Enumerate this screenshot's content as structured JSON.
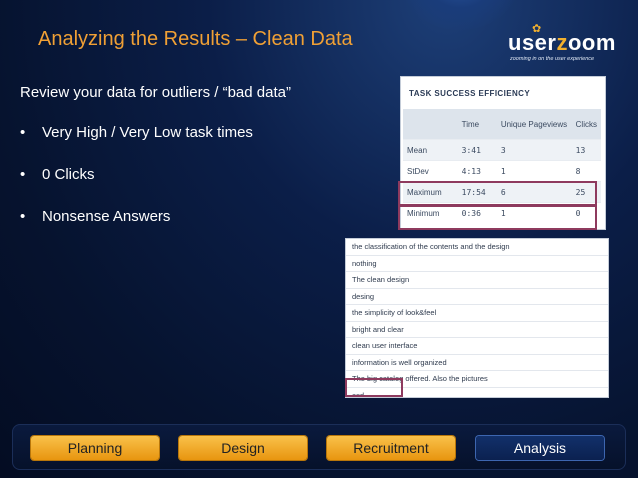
{
  "slide": {
    "title": "Analyzing the Results – Clean Data",
    "intro": "Review your data for outliers / “bad data”",
    "bullets": [
      "Very High / Very Low task times",
      "0 Clicks",
      "Nonsense Answers"
    ],
    "bullet_glyph": "•"
  },
  "logo": {
    "word_prefix": "user",
    "word_accent": "z",
    "word_suffix": "oom",
    "tagline": "zooming in on the user experience",
    "accent_color": "#f3b12e"
  },
  "task_table": {
    "title": "TASK SUCCESS EFFICIENCY",
    "columns": [
      "",
      "Time",
      "Unique Pageviews",
      "Clicks"
    ],
    "rows": [
      {
        "label": "Mean",
        "time": "3:41",
        "pageviews": "3",
        "clicks": "13"
      },
      {
        "label": "StDev",
        "time": "4:13",
        "pageviews": "1",
        "clicks": "8"
      },
      {
        "label": "Maximum",
        "time": "17:54",
        "pageviews": "6",
        "clicks": "25"
      },
      {
        "label": "Minimum",
        "time": "0:36",
        "pageviews": "1",
        "clicks": "0"
      }
    ],
    "highlight_color": "#8e3a5e"
  },
  "answers": [
    "the classification of the contents and the design",
    "nothing",
    "The clean design",
    "desing",
    "the simplicity of look&feel",
    "bright and clear",
    "clean user interface",
    "information is well organized",
    "The big catalog offered. Also the pictures",
    "asd"
  ],
  "nav": {
    "items": [
      "Planning",
      "Design",
      "Recruitment",
      "Analysis"
    ],
    "active": "Analysis",
    "title_color": "#f0a035"
  }
}
